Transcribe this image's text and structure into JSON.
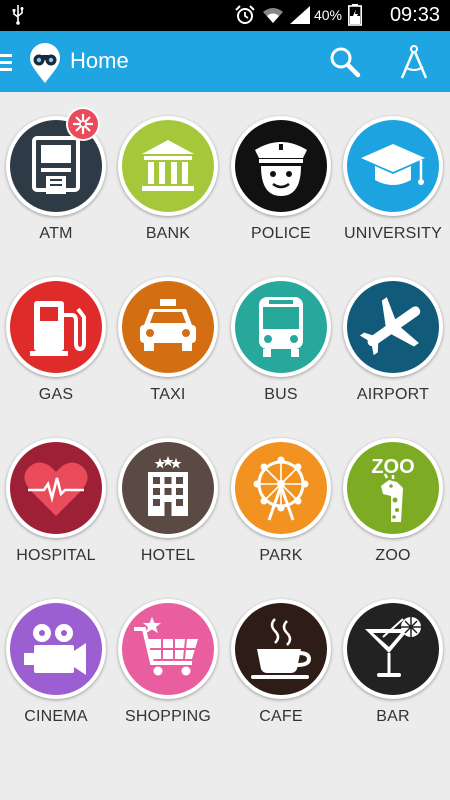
{
  "status_bar": {
    "battery_percent": "40%",
    "time": "09:33",
    "icons": [
      "usb-icon",
      "alarm-icon",
      "wifi-icon",
      "signal-icon",
      "battery-icon"
    ]
  },
  "app_bar": {
    "title": "Home",
    "icons": [
      "menu-icon",
      "binoculars-logo-icon",
      "search-icon",
      "compass-icon"
    ]
  },
  "colors": {
    "app_bar": "#1fa5e1",
    "background": "#ececec",
    "badge": "#e94b5a"
  },
  "categories": [
    {
      "label": "ATM",
      "color": "#2e3a45",
      "icon": "atm-icon"
    },
    {
      "label": "BANK",
      "color": "#a5c83a",
      "icon": "bank-icon"
    },
    {
      "label": "POLICE",
      "color": "#111111",
      "icon": "police-icon"
    },
    {
      "label": "UNIVERSITY",
      "color": "#1da4e0",
      "icon": "graduation-cap-icon"
    },
    {
      "label": "GAS",
      "color": "#e02b2b",
      "icon": "gas-pump-icon"
    },
    {
      "label": "TAXI",
      "color": "#d46e12",
      "icon": "taxi-icon"
    },
    {
      "label": "BUS",
      "color": "#28a89a",
      "icon": "bus-icon"
    },
    {
      "label": "AIRPORT",
      "color": "#115a7a",
      "icon": "airplane-icon"
    },
    {
      "label": "HOSPITAL",
      "color": "#9e2036",
      "icon": "heart-pulse-icon"
    },
    {
      "label": "HOTEL",
      "color": "#5b4a43",
      "icon": "hotel-icon"
    },
    {
      "label": "PARK",
      "color": "#f29220",
      "icon": "ferris-wheel-icon"
    },
    {
      "label": "ZOO",
      "color": "#7dac24",
      "icon": "giraffe-icon"
    },
    {
      "label": "CINEMA",
      "color": "#9b5fd1",
      "icon": "movie-camera-icon"
    },
    {
      "label": "SHOPPING",
      "color": "#e95e9e",
      "icon": "shopping-cart-icon"
    },
    {
      "label": "CAFE",
      "color": "#2e1c16",
      "icon": "coffee-cup-icon"
    },
    {
      "label": "BAR",
      "color": "#222222",
      "icon": "cocktail-icon"
    }
  ],
  "zoo_sign": "ZOO"
}
